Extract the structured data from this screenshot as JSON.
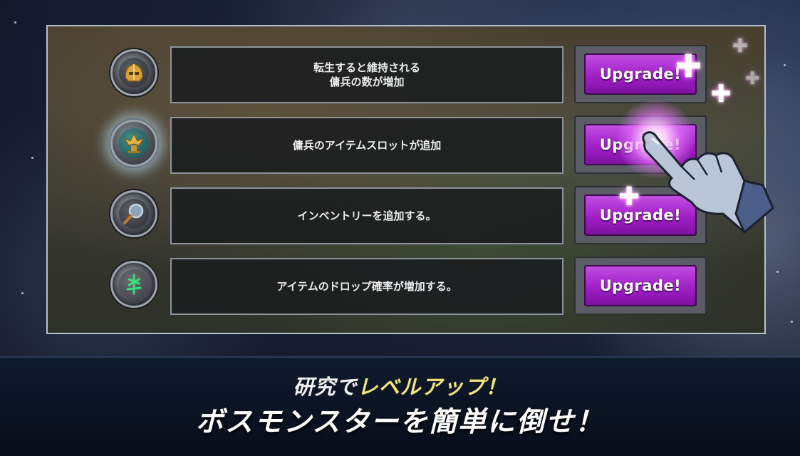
{
  "research_list": {
    "items": [
      {
        "description": [
          "転生すると維持される",
          "傭兵の数が増加"
        ],
        "button_label": "Upgrade!",
        "icon": "golden-helmet-icon"
      },
      {
        "description": [
          "傭兵のアイテムスロットが追加"
        ],
        "button_label": "Upgrade!",
        "icon": "golden-eagle-statue-icon"
      },
      {
        "description": [
          "インベントリーを追加する。"
        ],
        "button_label": "Upgrade!",
        "icon": "magnifying-glass-icon"
      },
      {
        "description": [
          "アイテムのドロップ確率が増加する。"
        ],
        "button_label": "Upgrade!",
        "icon": "green-rune-icon"
      }
    ]
  },
  "caption": {
    "line1_plain": "研究で",
    "line1_highlight": "レベルアップ！",
    "line2": "ボスモンスターを簡単に倒せ！"
  },
  "colors": {
    "button_purple": "#a11fc7",
    "highlight_yellow": "#f3e27a",
    "panel_border": "#b9c0cc"
  }
}
